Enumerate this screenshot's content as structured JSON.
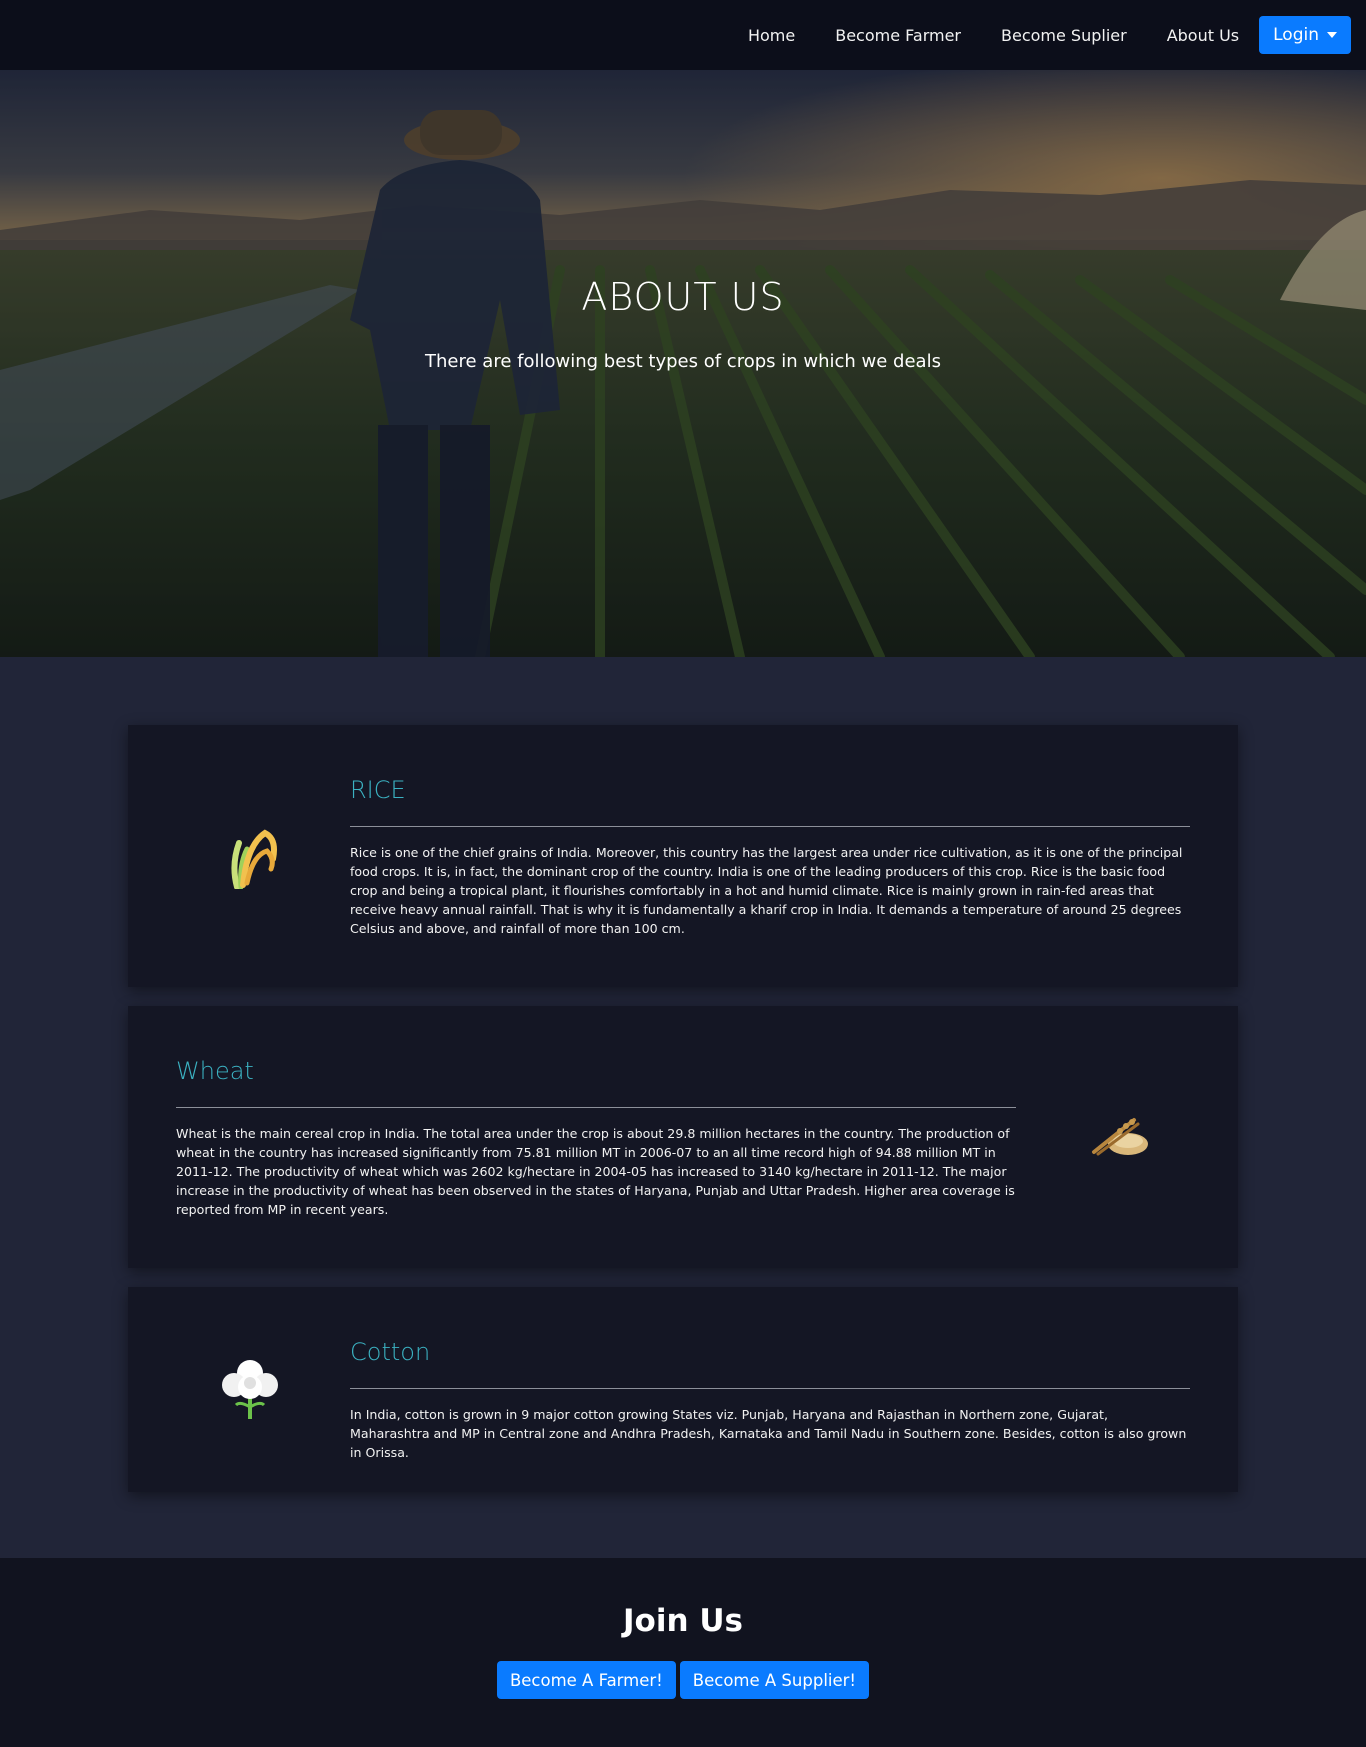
{
  "nav": {
    "links": [
      {
        "label": "Home"
      },
      {
        "label": "Become Farmer"
      },
      {
        "label": "Become Suplier"
      },
      {
        "label": "About Us"
      }
    ],
    "login_label": "Login"
  },
  "hero": {
    "title": "ABOUT US",
    "subtitle": "There are following best types of crops in which we deals"
  },
  "crops": [
    {
      "title": "RICE",
      "icon": "rice-plant-icon",
      "text": "Rice is one of the chief grains of India. Moreover, this country has the largest area under rice cultivation, as it is one of the principal food crops. It is, in fact, the dominant crop of the country. India is one of the leading producers of this crop. Rice is the basic food crop and being a tropical plant, it flourishes comfortably in a hot and humid climate. Rice is mainly grown in rain-fed areas that receive heavy annual rainfall. That is why it is fundamentally a kharif crop in India. It demands a temperature of around 25 degrees Celsius and above, and rainfall of more than 100 cm."
    },
    {
      "title": "Wheat",
      "icon": "wheat-grain-icon",
      "text": "Wheat is the main cereal crop in India. The total area under the crop is about 29.8 million hectares in the country. The production of wheat in the country has increased significantly from 75.81 million MT in 2006-07 to an all time record high of 94.88 million MT in 2011-12. The productivity of wheat which was 2602 kg/hectare in 2004-05 has increased to 3140 kg/hectare in 2011-12. The major increase in the productivity of wheat has been observed in the states of Haryana, Punjab and Uttar Pradesh. Higher area coverage is reported from MP in recent years."
    },
    {
      "title": "Cotton",
      "icon": "cotton-plant-icon",
      "text": "In India, cotton is grown in 9 major cotton growing States viz. Punjab, Haryana and Rajasthan in Northern zone, Gujarat, Maharashtra and MP in Central zone and Andhra Pradesh, Karnataka and Tamil Nadu in Southern zone. Besides, cotton is also grown in Orissa."
    }
  ],
  "footer": {
    "title": "Join Us",
    "farmer_button": "Become A Farmer!",
    "supplier_button": "Become A Supplier!"
  },
  "colors": {
    "accent": "#0a7bff",
    "heading_teal": "#3bb2c2",
    "card_bg": "#141624",
    "page_bg": "#212538",
    "nav_bg": "#0c0e1a"
  }
}
